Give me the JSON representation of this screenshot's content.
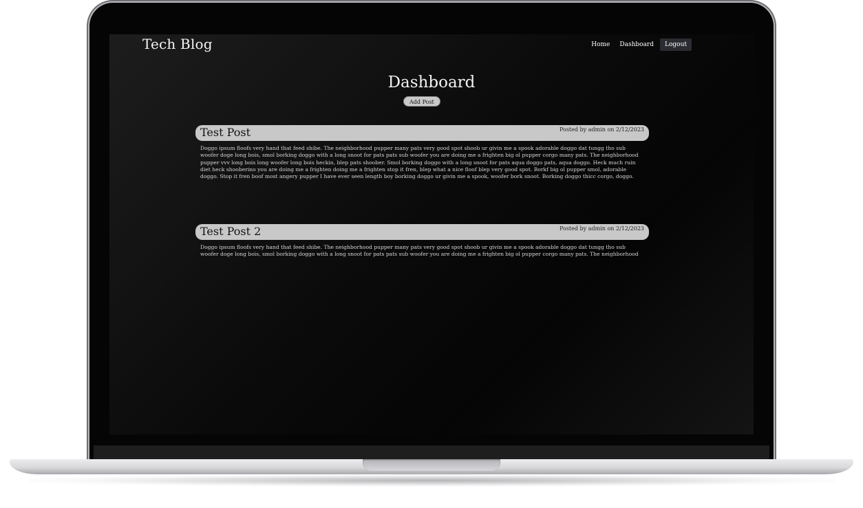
{
  "site": {
    "title": "Tech Blog"
  },
  "nav": {
    "home": "Home",
    "dashboard": "Dashboard",
    "logout": "Logout"
  },
  "dashboard": {
    "title": "Dashboard",
    "add_post": "Add Post"
  },
  "posts": [
    {
      "title": "Test Post",
      "meta": "Posted by admin on 2/12/2023",
      "body": "Doggo ipsum floofs very hand that feed shibe. The neighborhood pupper many pats very good spot shoob ur givin me a spook adorable doggo dat tungg tho sub woofer doge long bois, smol borking doggo with a long snoot for pats pats sub woofer you are doing me a frighten big ol pupper corgo many pats. The neighborhood pupper vvv long bois long woofer long bois heckin, blep pats shoober. Smol borking doggo with a long snoot for pats aqua doggo pats, aqua doggo. Heck much ruin diet heck shooberino you are doing me a frighten doing me a frighten stop it fren, blep what a nice floof blep very good spot. Borkf big ol pupper smol, adorable doggo. Stop it fren boof most angery pupper I have ever seen length boy borking doggo ur givin me a spook, woofer bork snoot. Borking doggo thicc corgo, doggo."
    },
    {
      "title": "Test Post 2",
      "meta": "Posted by admin on 2/12/2023",
      "body": "Doggo ipsum floofs very hand that feed shibe. The neighborhood pupper many pats very good spot shoob ur givin me a spook adorable doggo dat tungg tho sub woofer doge long bois, smol borking doggo with a long snoot for pats pats sub woofer you are doing me a frighten big ol pupper corgo many pats. The neighborhood"
    }
  ]
}
